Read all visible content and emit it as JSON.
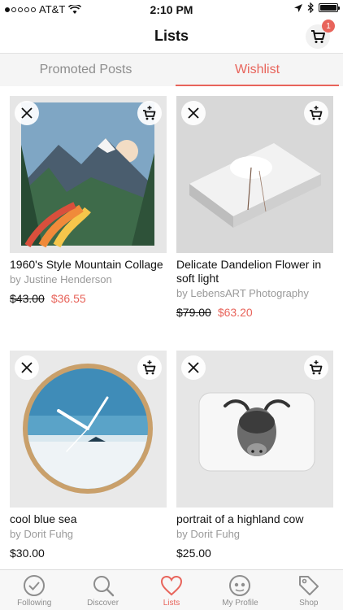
{
  "status_bar": {
    "carrier": "AT&T",
    "time": "2:10 PM",
    "signal_strength": 1,
    "signal_max": 5,
    "battery_level": 1.0
  },
  "nav": {
    "title": "Lists",
    "cart_badge": "1"
  },
  "tabs": [
    {
      "label": "Promoted Posts",
      "active": false
    },
    {
      "label": "Wishlist",
      "active": true
    }
  ],
  "products": [
    {
      "title": "1960's Style Mountain Collage",
      "artist": "by Justine Henderson",
      "old_price": "$43.00",
      "price": "$36.55",
      "image": "mountain-tapestry"
    },
    {
      "title": "Delicate Dandelion Flower in soft light",
      "artist": "by LebensART Photography",
      "old_price": "$79.00",
      "price": "$63.20",
      "image": "dandelion-floor-pillow"
    },
    {
      "title": "cool blue sea",
      "artist": "by Dorit Fuhg",
      "old_price": "",
      "price": "$30.00",
      "image": "blue-sea-wall-clock"
    },
    {
      "title": "portrait of a highland cow",
      "artist": "by Dorit Fuhg",
      "old_price": "",
      "price": "$25.00",
      "image": "highland-cow-bath-mat"
    }
  ],
  "tab_bar": [
    {
      "label": "Following",
      "icon": "check-circle-icon",
      "active": false
    },
    {
      "label": "Discover",
      "icon": "search-icon",
      "active": false
    },
    {
      "label": "Lists",
      "icon": "heart-icon",
      "active": true
    },
    {
      "label": "My Profile",
      "icon": "profile-face-icon",
      "active": false
    },
    {
      "label": "Shop",
      "icon": "tag-icon",
      "active": false
    }
  ],
  "colors": {
    "accent": "#e8645b",
    "muted_text": "#9a9a9a"
  }
}
